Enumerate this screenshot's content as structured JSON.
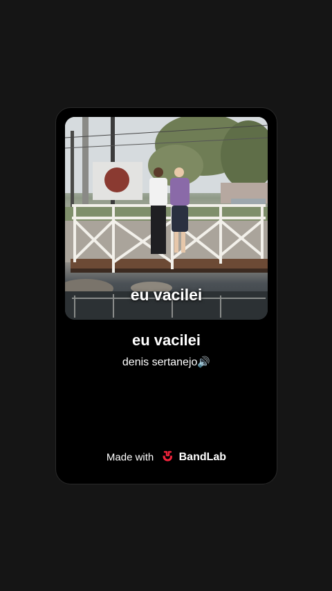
{
  "card": {
    "artwork_caption": "eu vacilei",
    "track_title": "eu vacilei",
    "artist_name": "denis sertanejo",
    "artist_emoji": "🔊",
    "made_with_label": "Made with",
    "brand_name": "BandLab",
    "brand_icon": "bandlab-logo-icon"
  },
  "colors": {
    "background": "#151515",
    "card": "#000000",
    "brand_red": "#f0233b",
    "text": "#ffffff"
  }
}
